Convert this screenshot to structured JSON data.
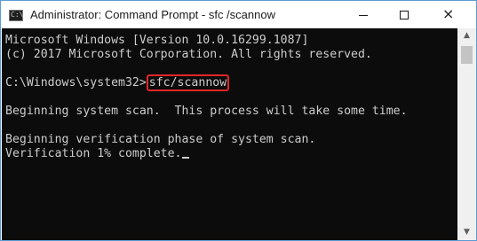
{
  "window": {
    "title": "Administrator: Command Prompt - sfc /scannow",
    "icon": "cmd-icon",
    "icon_glyph": "C:\\",
    "controls": {
      "minimize": "minimize-icon",
      "maximize": "maximize-icon",
      "close": "×"
    }
  },
  "console": {
    "lines": [
      "Microsoft Windows [Version 10.0.16299.1087]",
      "(c) 2017 Microsoft Corporation. All rights reserved.",
      "",
      "C:\\Windows\\system32>",
      "",
      "Beginning system scan.  This process will take some time.",
      "",
      "Beginning verification phase of system scan.",
      "Verification 1% complete."
    ],
    "prompt": "C:\\Windows\\system32>",
    "command": "sfc/scannow",
    "highlight_color": "#e0262a",
    "background": "#0c0c0c",
    "foreground": "#cccccc"
  },
  "scrollbar": {
    "up": "▲",
    "down": "▼"
  }
}
